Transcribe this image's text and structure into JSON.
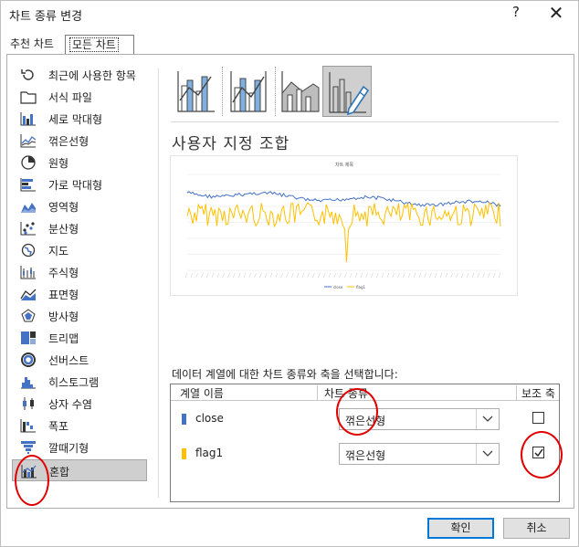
{
  "window": {
    "title": "차트 종류 변경",
    "help_label": "?",
    "close_label": "✕"
  },
  "tabs": [
    {
      "label": "추천 차트",
      "selected": false
    },
    {
      "label": "모든 차트",
      "selected": true
    }
  ],
  "sidebar": {
    "items": [
      {
        "label": "최근에 사용한 항목",
        "icon": "recent-icon"
      },
      {
        "label": "서식 파일",
        "icon": "folder-icon"
      },
      {
        "label": "세로 막대형",
        "icon": "column-chart-icon"
      },
      {
        "label": "꺾은선형",
        "icon": "line-chart-icon"
      },
      {
        "label": "원형",
        "icon": "pie-chart-icon"
      },
      {
        "label": "가로 막대형",
        "icon": "bar-chart-icon"
      },
      {
        "label": "영역형",
        "icon": "area-chart-icon"
      },
      {
        "label": "분산형",
        "icon": "scatter-chart-icon"
      },
      {
        "label": "지도",
        "icon": "map-chart-icon"
      },
      {
        "label": "주식형",
        "icon": "stock-chart-icon"
      },
      {
        "label": "표면형",
        "icon": "surface-chart-icon"
      },
      {
        "label": "방사형",
        "icon": "radar-chart-icon"
      },
      {
        "label": "트리맵",
        "icon": "treemap-chart-icon"
      },
      {
        "label": "선버스트",
        "icon": "sunburst-chart-icon"
      },
      {
        "label": "히스토그램",
        "icon": "histogram-chart-icon"
      },
      {
        "label": "상자 수염",
        "icon": "box-whisker-chart-icon"
      },
      {
        "label": "폭포",
        "icon": "waterfall-chart-icon"
      },
      {
        "label": "깔때기형",
        "icon": "funnel-chart-icon"
      },
      {
        "label": "혼합",
        "icon": "combo-chart-icon",
        "selected": true
      }
    ]
  },
  "subtypes": [
    {
      "name": "clustered-column-line",
      "icon": "combo-column-line-icon"
    },
    {
      "name": "clustered-column-line-secondary",
      "icon": "combo-column-line-secondary-icon"
    },
    {
      "name": "stacked-area-column",
      "icon": "combo-area-column-icon"
    },
    {
      "name": "custom-combination",
      "icon": "custom-combo-icon",
      "selected": true
    }
  ],
  "section_title": "사용자 지정 조합",
  "preview": {
    "title": "차트 제목",
    "legend": [
      {
        "name": "close",
        "color": "#4472c4"
      },
      {
        "name": "flag1",
        "color": "#ffc000"
      }
    ]
  },
  "instruction": "데이터 계열에 대한 차트 종류와 축을 선택합니다:",
  "series_table": {
    "headers": {
      "name": "계열 이름",
      "chart_type": "차트 종류",
      "secondary_axis": "보조 축"
    },
    "rows": [
      {
        "name": "close",
        "color": "#4472c4",
        "chart_type": "꺾은선형",
        "secondary_axis": false
      },
      {
        "name": "flag1",
        "color": "#ffc000",
        "chart_type": "꺾은선형",
        "secondary_axis": true
      }
    ]
  },
  "buttons": {
    "ok": "확인",
    "cancel": "취소"
  },
  "colors": {
    "annotation": "#e00000",
    "selection": "#cfcfcf",
    "accent": "#0078d7"
  }
}
